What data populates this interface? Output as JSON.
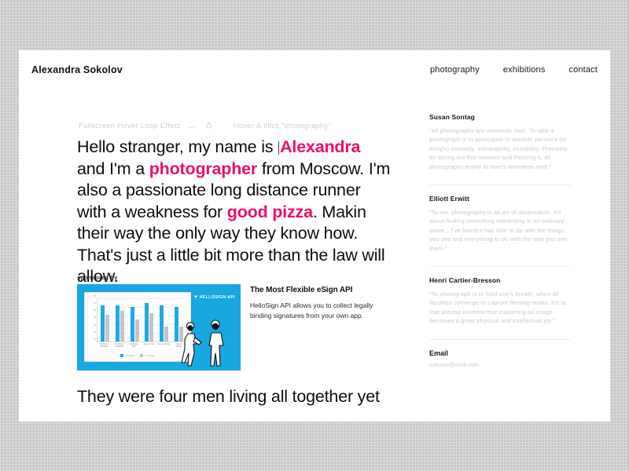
{
  "header": {
    "brand": "Alexandra Sokolov",
    "nav": [
      {
        "label": "photography"
      },
      {
        "label": "exhibitions"
      },
      {
        "label": "contact"
      }
    ]
  },
  "hint_bar": {
    "left_text": "Fullscreen Hover Loop Effect",
    "arrow": "←",
    "icon": "droplet-icon",
    "right_text": "Hover & click \"photography\""
  },
  "headline": {
    "part1": "Hello stranger, my name is ",
    "accent1": "Alexandra",
    "part2": " and I'm a ",
    "accent2": "photographer",
    "part3": " from Moscow. I'm also a passionate long distance runner with a weakness for ",
    "accent3": "good pizza",
    "part4": ". Makin their way the only way they know how. That's just a little bit more than the law will allow."
  },
  "lower_headline": {
    "text": "They were four men living all together yet"
  },
  "ad": {
    "sponsor_label": "sponsored by",
    "logo_text": "HELLOSIGN API",
    "title": "The Most Flexible eSign API",
    "description": "HelloSign API allows you to collect legally binding signatures from your own app."
  },
  "chart_data": {
    "type": "bar",
    "title": "",
    "xlabel": "",
    "ylabel": "",
    "ylim": [
      0,
      90
    ],
    "yticks": [
      "90",
      "74",
      "62",
      "48",
      "36",
      "24",
      "14"
    ],
    "grid": true,
    "legend_position": "bottom",
    "categories": [
      "Notification Reliability",
      "Enterprise Scalability",
      "Integration APIs",
      "Ease of Use",
      "Ease of Admin",
      "Support Quality"
    ],
    "series": [
      {
        "name": "HelloSign",
        "values": [
          74,
          74,
          70,
          78,
          74,
          70
        ]
      },
      {
        "name": "DocuSign",
        "values": [
          55,
          62,
          45,
          58,
          30,
          30
        ]
      }
    ]
  },
  "sidebar": {
    "quotes": [
      {
        "author": "Susan Sontag",
        "text": "“All photographs are memento mori. To take a photograph is to participate in another person’s (or thing’s) mortality, vulnerability, mutability. Precisely by slicing out this moment and freezing it, all photographs testify to time’s relentless melt.”"
      },
      {
        "author": "Elliott Erwitt",
        "text": "“To me, photography is an art of observation. It’s about finding something interesting in an ordinary place... I’ve found it has little to do with the things you see and everything to do with the way you see them.”"
      },
      {
        "author": "Henri Cartier-Bresson",
        "text": "“To photograph is to hold one’s breath, when all faculties converge to capture fleeting reality. It’s at that precise moment that mastering an image becomes a great physical and intellectual joy.”"
      }
    ],
    "email_label": "Email",
    "email_value": "sokolov@mail.com"
  },
  "colors": {
    "accent_pink": "#ec0f69",
    "ad_cyan": "#19a7e0",
    "bar_primary": "#1fa9e6",
    "bar_secondary": "#c4c4c4",
    "backdrop": "#c9c9c9"
  }
}
